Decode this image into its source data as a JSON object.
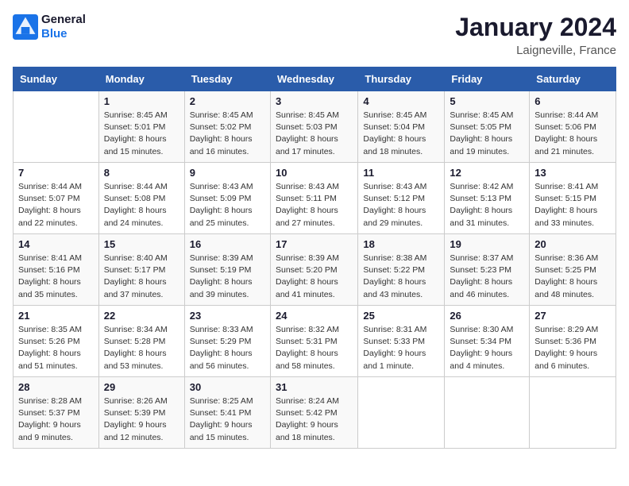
{
  "header": {
    "logo_line1": "General",
    "logo_line2": "Blue",
    "month": "January 2024",
    "location": "Laigneville, France"
  },
  "columns": [
    "Sunday",
    "Monday",
    "Tuesday",
    "Wednesday",
    "Thursday",
    "Friday",
    "Saturday"
  ],
  "weeks": [
    [
      {
        "day": "",
        "info": ""
      },
      {
        "day": "1",
        "info": "Sunrise: 8:45 AM\nSunset: 5:01 PM\nDaylight: 8 hours\nand 15 minutes."
      },
      {
        "day": "2",
        "info": "Sunrise: 8:45 AM\nSunset: 5:02 PM\nDaylight: 8 hours\nand 16 minutes."
      },
      {
        "day": "3",
        "info": "Sunrise: 8:45 AM\nSunset: 5:03 PM\nDaylight: 8 hours\nand 17 minutes."
      },
      {
        "day": "4",
        "info": "Sunrise: 8:45 AM\nSunset: 5:04 PM\nDaylight: 8 hours\nand 18 minutes."
      },
      {
        "day": "5",
        "info": "Sunrise: 8:45 AM\nSunset: 5:05 PM\nDaylight: 8 hours\nand 19 minutes."
      },
      {
        "day": "6",
        "info": "Sunrise: 8:44 AM\nSunset: 5:06 PM\nDaylight: 8 hours\nand 21 minutes."
      }
    ],
    [
      {
        "day": "7",
        "info": "Sunrise: 8:44 AM\nSunset: 5:07 PM\nDaylight: 8 hours\nand 22 minutes."
      },
      {
        "day": "8",
        "info": "Sunrise: 8:44 AM\nSunset: 5:08 PM\nDaylight: 8 hours\nand 24 minutes."
      },
      {
        "day": "9",
        "info": "Sunrise: 8:43 AM\nSunset: 5:09 PM\nDaylight: 8 hours\nand 25 minutes."
      },
      {
        "day": "10",
        "info": "Sunrise: 8:43 AM\nSunset: 5:11 PM\nDaylight: 8 hours\nand 27 minutes."
      },
      {
        "day": "11",
        "info": "Sunrise: 8:43 AM\nSunset: 5:12 PM\nDaylight: 8 hours\nand 29 minutes."
      },
      {
        "day": "12",
        "info": "Sunrise: 8:42 AM\nSunset: 5:13 PM\nDaylight: 8 hours\nand 31 minutes."
      },
      {
        "day": "13",
        "info": "Sunrise: 8:41 AM\nSunset: 5:15 PM\nDaylight: 8 hours\nand 33 minutes."
      }
    ],
    [
      {
        "day": "14",
        "info": "Sunrise: 8:41 AM\nSunset: 5:16 PM\nDaylight: 8 hours\nand 35 minutes."
      },
      {
        "day": "15",
        "info": "Sunrise: 8:40 AM\nSunset: 5:17 PM\nDaylight: 8 hours\nand 37 minutes."
      },
      {
        "day": "16",
        "info": "Sunrise: 8:39 AM\nSunset: 5:19 PM\nDaylight: 8 hours\nand 39 minutes."
      },
      {
        "day": "17",
        "info": "Sunrise: 8:39 AM\nSunset: 5:20 PM\nDaylight: 8 hours\nand 41 minutes."
      },
      {
        "day": "18",
        "info": "Sunrise: 8:38 AM\nSunset: 5:22 PM\nDaylight: 8 hours\nand 43 minutes."
      },
      {
        "day": "19",
        "info": "Sunrise: 8:37 AM\nSunset: 5:23 PM\nDaylight: 8 hours\nand 46 minutes."
      },
      {
        "day": "20",
        "info": "Sunrise: 8:36 AM\nSunset: 5:25 PM\nDaylight: 8 hours\nand 48 minutes."
      }
    ],
    [
      {
        "day": "21",
        "info": "Sunrise: 8:35 AM\nSunset: 5:26 PM\nDaylight: 8 hours\nand 51 minutes."
      },
      {
        "day": "22",
        "info": "Sunrise: 8:34 AM\nSunset: 5:28 PM\nDaylight: 8 hours\nand 53 minutes."
      },
      {
        "day": "23",
        "info": "Sunrise: 8:33 AM\nSunset: 5:29 PM\nDaylight: 8 hours\nand 56 minutes."
      },
      {
        "day": "24",
        "info": "Sunrise: 8:32 AM\nSunset: 5:31 PM\nDaylight: 8 hours\nand 58 minutes."
      },
      {
        "day": "25",
        "info": "Sunrise: 8:31 AM\nSunset: 5:33 PM\nDaylight: 9 hours\nand 1 minute."
      },
      {
        "day": "26",
        "info": "Sunrise: 8:30 AM\nSunset: 5:34 PM\nDaylight: 9 hours\nand 4 minutes."
      },
      {
        "day": "27",
        "info": "Sunrise: 8:29 AM\nSunset: 5:36 PM\nDaylight: 9 hours\nand 6 minutes."
      }
    ],
    [
      {
        "day": "28",
        "info": "Sunrise: 8:28 AM\nSunset: 5:37 PM\nDaylight: 9 hours\nand 9 minutes."
      },
      {
        "day": "29",
        "info": "Sunrise: 8:26 AM\nSunset: 5:39 PM\nDaylight: 9 hours\nand 12 minutes."
      },
      {
        "day": "30",
        "info": "Sunrise: 8:25 AM\nSunset: 5:41 PM\nDaylight: 9 hours\nand 15 minutes."
      },
      {
        "day": "31",
        "info": "Sunrise: 8:24 AM\nSunset: 5:42 PM\nDaylight: 9 hours\nand 18 minutes."
      },
      {
        "day": "",
        "info": ""
      },
      {
        "day": "",
        "info": ""
      },
      {
        "day": "",
        "info": ""
      }
    ]
  ]
}
